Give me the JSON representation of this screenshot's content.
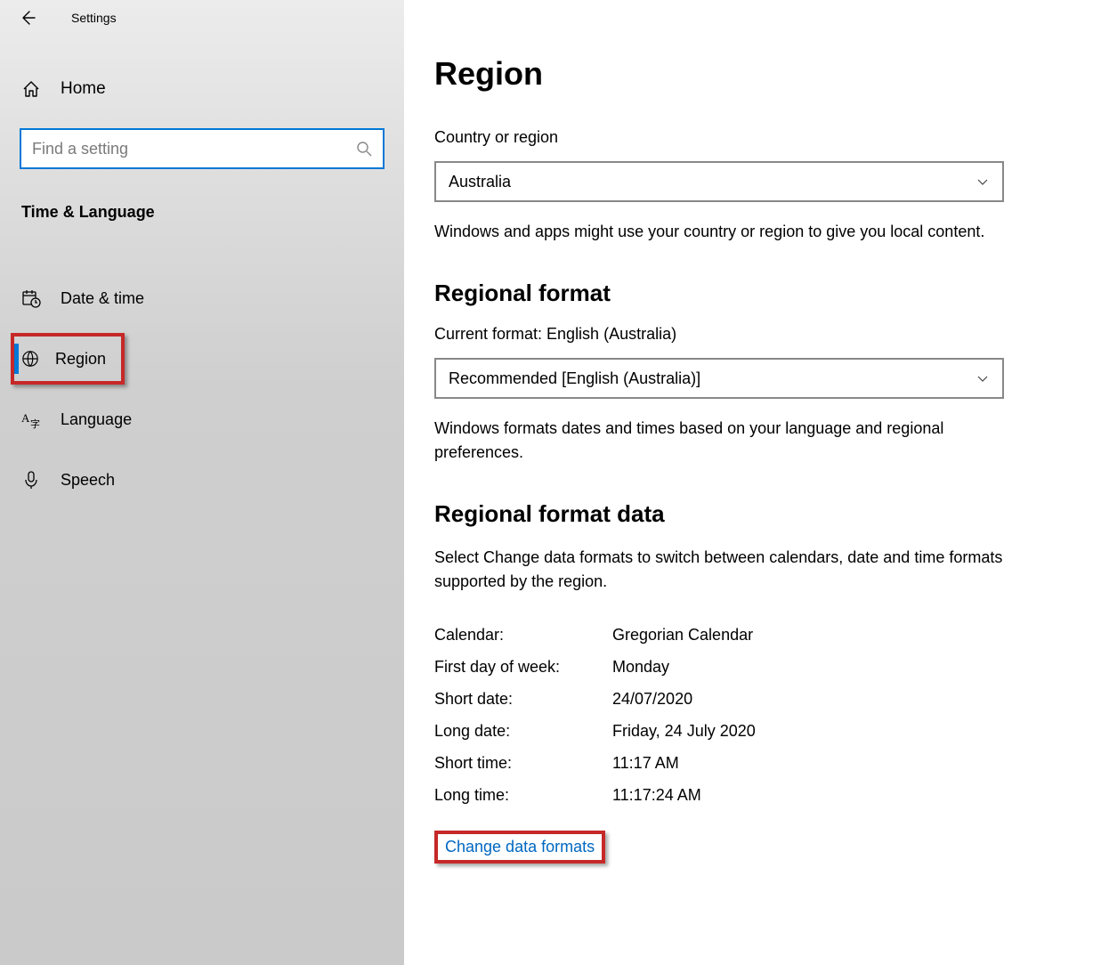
{
  "titlebar": {
    "title": "Settings"
  },
  "sidebar": {
    "home": "Home",
    "search_placeholder": "Find a setting",
    "category": "Time & Language",
    "items": [
      {
        "label": "Date & time"
      },
      {
        "label": "Region"
      },
      {
        "label": "Language"
      },
      {
        "label": "Speech"
      }
    ]
  },
  "main": {
    "title": "Region",
    "country_label": "Country or region",
    "country_value": "Australia",
    "country_desc": "Windows and apps might use your country or region to give you local content.",
    "format_heading": "Regional format",
    "format_current": "Current format: English (Australia)",
    "format_value": "Recommended [English (Australia)]",
    "format_desc": "Windows formats dates and times based on your language and regional preferences.",
    "data_heading": "Regional format data",
    "data_desc": "Select Change data formats to switch between calendars, date and time formats supported by the region.",
    "rows": {
      "calendar_k": "Calendar:",
      "calendar_v": "Gregorian Calendar",
      "firstday_k": "First day of week:",
      "firstday_v": "Monday",
      "shortdate_k": "Short date:",
      "shortdate_v": "24/07/2020",
      "longdate_k": "Long date:",
      "longdate_v": "Friday, 24 July 2020",
      "shorttime_k": "Short time:",
      "shorttime_v": "11:17 AM",
      "longtime_k": "Long time:",
      "longtime_v": "11:17:24 AM"
    },
    "change_link": "Change data formats"
  }
}
